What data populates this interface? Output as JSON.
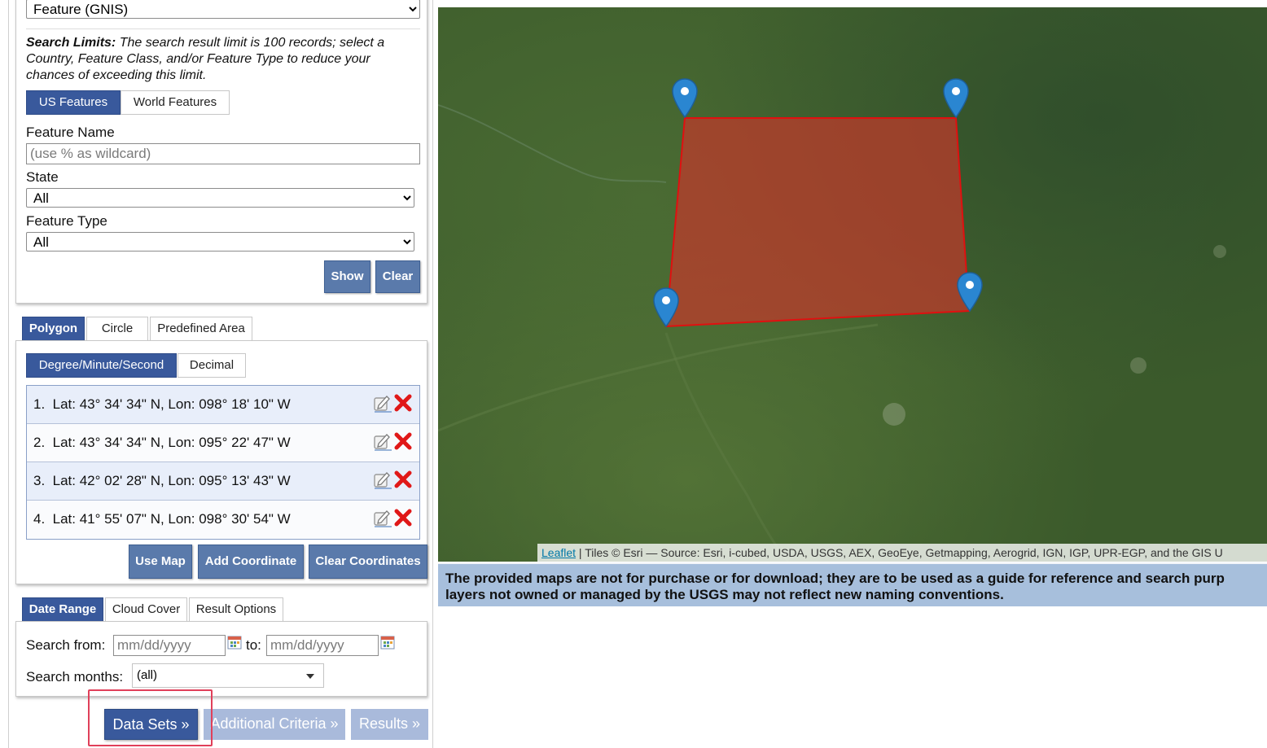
{
  "feature_search": {
    "top_select_value": "Feature (GNIS)",
    "search_limits_label": "Search Limits:",
    "search_limits_text": "The search result limit is 100 records; select a Country, Feature Class, and/or Feature Type to reduce your chances of exceeding this limit.",
    "tabs": [
      "US Features",
      "World Features"
    ],
    "feature_name_label": "Feature Name",
    "feature_name_placeholder": "(use % as wildcard)",
    "state_label": "State",
    "state_value": "All",
    "feature_type_label": "Feature Type",
    "feature_type_value": "All",
    "show_label": "Show",
    "clear_label": "Clear"
  },
  "area": {
    "tabs": [
      "Polygon",
      "Circle",
      "Predefined Area"
    ],
    "format_tabs": [
      "Degree/Minute/Second",
      "Decimal"
    ],
    "coordinates": [
      {
        "index": "1.",
        "text": "Lat: 43° 34' 34\" N, Lon: 098° 18' 10\" W"
      },
      {
        "index": "2.",
        "text": "Lat: 43° 34' 34\" N, Lon: 095° 22' 47\" W"
      },
      {
        "index": "3.",
        "text": "Lat: 42° 02' 28\" N, Lon: 095° 13' 43\" W"
      },
      {
        "index": "4.",
        "text": "Lat: 41° 55' 07\" N, Lon: 098° 30' 54\" W"
      }
    ],
    "use_map_label": "Use Map",
    "add_coordinate_label": "Add Coordinate",
    "clear_coordinates_label": "Clear Coordinates"
  },
  "date": {
    "tabs": [
      "Date Range",
      "Cloud Cover",
      "Result Options"
    ],
    "search_from_label": "Search from:",
    "to_label": "to:",
    "date_placeholder": "mm/dd/yyyy",
    "search_months_label": "Search months:",
    "search_months_value": "(all)"
  },
  "nav": {
    "data_sets": "Data Sets »",
    "additional_criteria": "Additional Criteria »",
    "results": "Results »"
  },
  "map": {
    "attribution_link": "Leaflet",
    "attribution_text": " | Tiles © Esri — Source: Esri, i-cubed, USDA, USGS, AEX, GeoEye, Getmapping, Aerogrid, IGN, IGP, UPR-EGP, and the GIS U",
    "disclaimer_line1": "The provided maps are not for purchase or for download; they are to be used as a guide for reference and search purp",
    "disclaimer_line2": "layers not owned or managed by the USGS may not reflect new naming conventions."
  },
  "colors": {
    "tab_active": "#39599c",
    "button": "#5a7aab",
    "polygon_fill": "#c0392b",
    "polygon_stroke": "#e01010",
    "highlight_box": "#e0405a",
    "marker": "#2a86d1"
  },
  "icons": [
    "edit-icon",
    "delete-icon",
    "calendar-icon",
    "map-marker-icon",
    "chevron-down-icon"
  ]
}
